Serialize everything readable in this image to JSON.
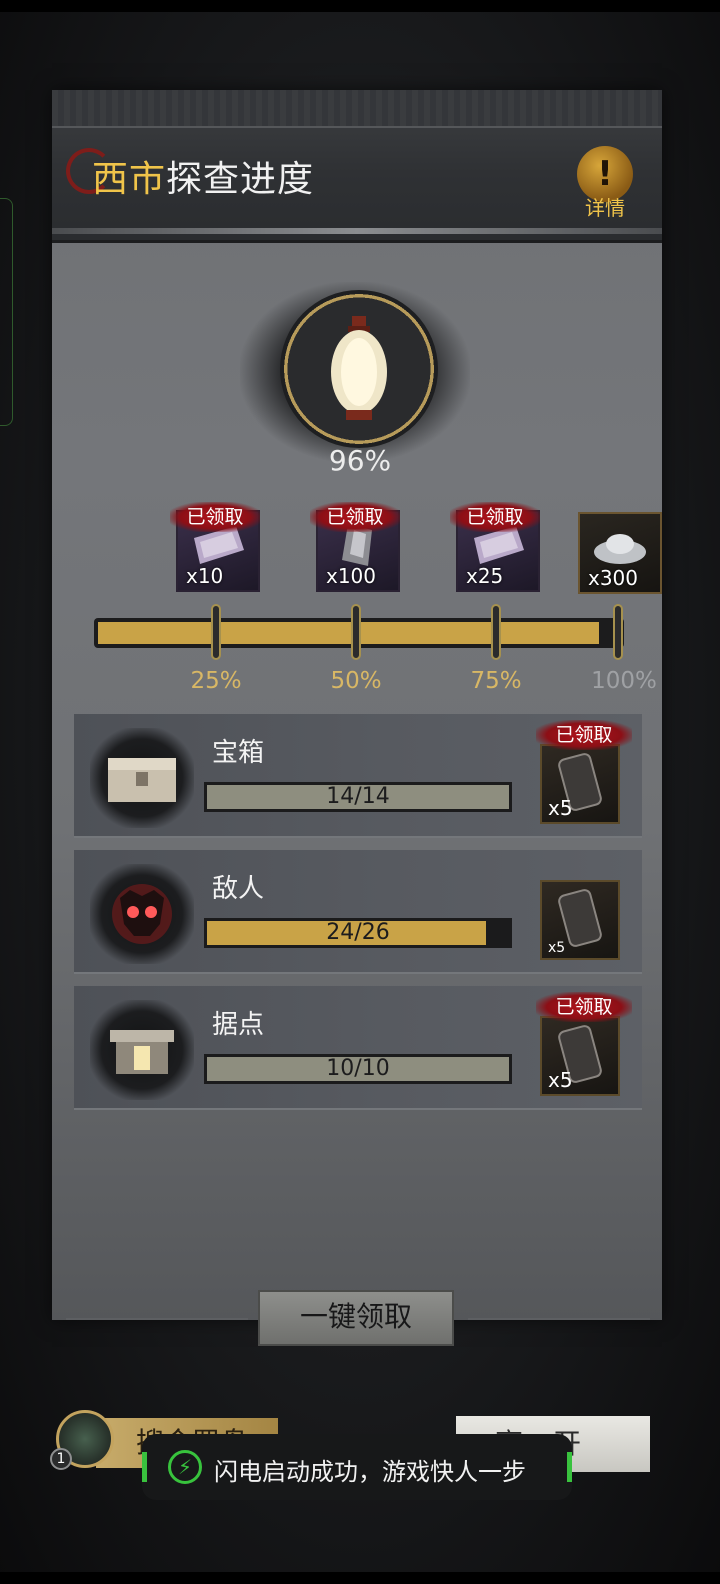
{
  "header": {
    "title_highlight": "西市",
    "title_rest": "探查进度",
    "info_icon": "exclamation-icon",
    "info_label": "详情"
  },
  "progress": {
    "percent_label": "96%",
    "percent_value": 96,
    "icon": "lantern-icon"
  },
  "milestones": [
    {
      "label": "25%",
      "reward_qty": "x10",
      "claimed_label": "已领取",
      "item": "purple-ingot",
      "reached": true
    },
    {
      "label": "50%",
      "reward_qty": "x100",
      "claimed_label": "已领取",
      "item": "ore-chunk",
      "reached": true
    },
    {
      "label": "75%",
      "reward_qty": "x25",
      "claimed_label": "已领取",
      "item": "purple-ingot",
      "reached": true
    },
    {
      "label": "100%",
      "reward_qty": "x300",
      "claimed_label": "",
      "item": "silver-ingot",
      "reached": false
    }
  ],
  "tasks": [
    {
      "name": "宝箱",
      "progress_text": "14/14",
      "current": 14,
      "total": 14,
      "reward_qty": "x5",
      "claimed_label": "已领取",
      "icon": "treasure-chest-icon"
    },
    {
      "name": "敌人",
      "progress_text": "24/26",
      "current": 24,
      "total": 26,
      "reward_qty": "x5",
      "claimed_label": "",
      "icon": "enemy-skull-icon"
    },
    {
      "name": "据点",
      "progress_text": "10/10",
      "current": 10,
      "total": 10,
      "reward_qty": "x5",
      "claimed_label": "已领取",
      "icon": "stronghold-icon"
    }
  ],
  "actions": {
    "claim_all": "一键领取",
    "compass": "搜金罗盘",
    "compass_badge": "1",
    "leave": "离开"
  },
  "toast": {
    "text": "闪电启动成功，游戏快人一步",
    "icon": "lightning-icon"
  },
  "colors": {
    "accent_gold": "#c9a347",
    "claimed_red": "#b0141c",
    "toast_green": "#39c23e"
  }
}
